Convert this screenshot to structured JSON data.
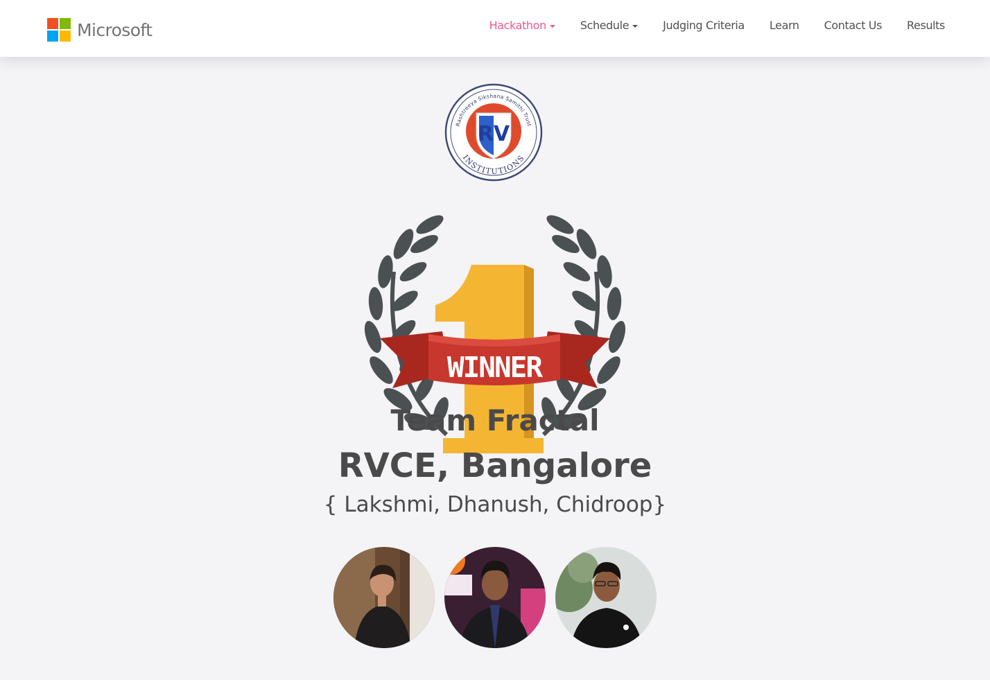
{
  "header": {
    "brand": "Microsoft",
    "brand_colors": [
      "#f25022",
      "#7fba00",
      "#00a4ef",
      "#ffb900"
    ],
    "nav": [
      {
        "label": "Hackathon",
        "dropdown": true,
        "active": true
      },
      {
        "label": "Schedule",
        "dropdown": true,
        "active": false
      },
      {
        "label": "Judging Criteria",
        "dropdown": false,
        "active": false
      },
      {
        "label": "Learn",
        "dropdown": false,
        "active": false
      },
      {
        "label": "Contact Us",
        "dropdown": false,
        "active": false
      },
      {
        "label": "Results",
        "dropdown": false,
        "active": false
      }
    ],
    "active_color": "#f2578b"
  },
  "winner": {
    "crest": {
      "initials": "RV",
      "ring_top": "Rashtreeya Sikshana Samithi Trust",
      "ring_bottom": "INSTITUTIONS"
    },
    "rank": "1",
    "ribbon": "WINNER",
    "team_name": "Team Fractal",
    "college": "RVCE, Bangalore",
    "members": "{ Lakshmi, Dhanush, Chidroop}",
    "colors": {
      "gold": "#f4b632",
      "ribbon": "#c8372d",
      "laurel": "#4b5052"
    }
  },
  "member_photos": [
    "member-photo-lakshmi",
    "member-photo-dhanush",
    "member-photo-chidroop"
  ]
}
